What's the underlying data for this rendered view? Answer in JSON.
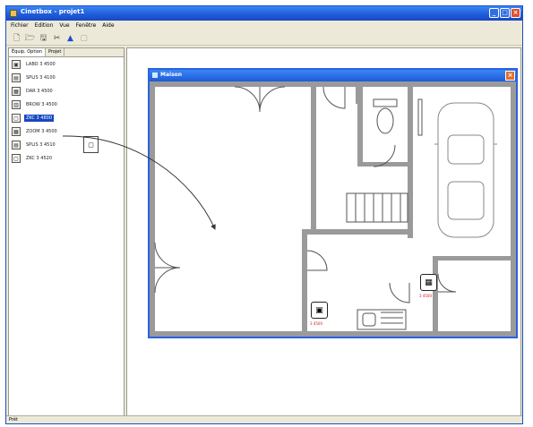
{
  "window": {
    "title": "Cinetbox - projet1",
    "min_glyph": "_",
    "max_glyph": "□",
    "close_glyph": "×"
  },
  "menu": [
    "Fichier",
    "Edition",
    "Vue",
    "Fenêtre",
    "Aide"
  ],
  "toolbar": [
    {
      "name": "new-file-icon",
      "glyph": "🗋"
    },
    {
      "name": "open-folder-icon",
      "glyph": "🗁"
    },
    {
      "name": "save-icon",
      "glyph": "🖫"
    },
    {
      "name": "cut-icon",
      "glyph": "✂"
    },
    {
      "name": "up-arrow-icon",
      "glyph": "▲"
    },
    {
      "name": "disabled-tool-icon",
      "glyph": "▢"
    }
  ],
  "panel": {
    "tabs": [
      "Équip. Option",
      "Projet"
    ],
    "devices": [
      {
        "label": "LABO 3 4500",
        "icon": "▣"
      },
      {
        "label": "SPLIS 3 4100",
        "icon": "▤"
      },
      {
        "label": "DAR 3 4500",
        "icon": "▦"
      },
      {
        "label": "BROW 3 4500",
        "icon": "▥"
      },
      {
        "label": "ZKC 3 4800",
        "icon": "▢",
        "selected": true
      },
      {
        "label": "ZOOM 3 4500",
        "icon": "▦"
      },
      {
        "label": "SPLIS 3 4510",
        "icon": "▤"
      },
      {
        "label": "ZKC 3 4520",
        "icon": "▢"
      }
    ]
  },
  "drag_ghost": "▢",
  "subwindow": {
    "title": "Maison",
    "close_glyph": "×"
  },
  "floor_devices": [
    {
      "name": "floor-device-2",
      "glyph": "▣",
      "label": "3 4500"
    },
    {
      "name": "floor-device-1",
      "glyph": "▦",
      "label": "3 4500"
    }
  ],
  "status": {
    "text": "Prêt"
  }
}
